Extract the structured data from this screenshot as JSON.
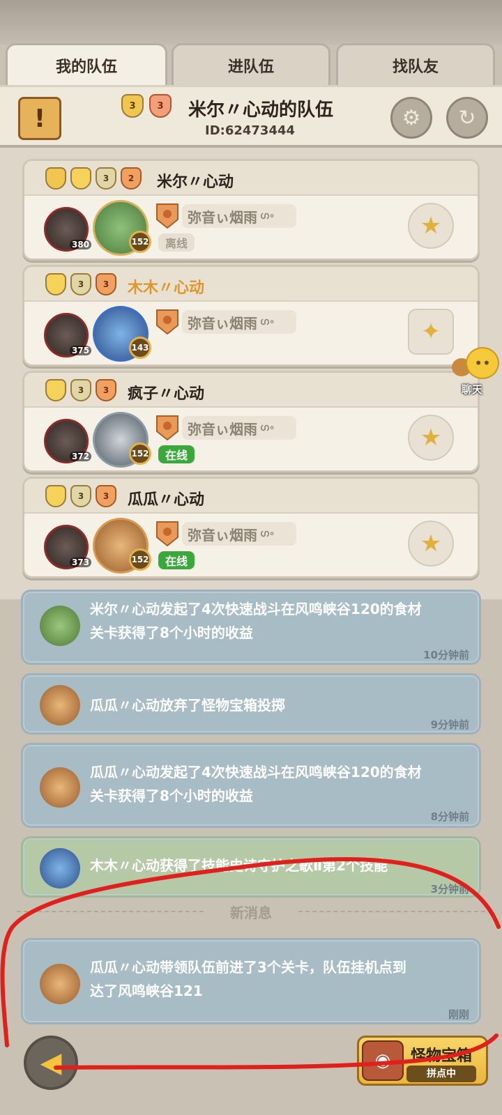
{
  "tabs": [
    {
      "label": "我的队伍",
      "active": true
    },
    {
      "label": "进队伍",
      "active": false
    },
    {
      "label": "找队友",
      "active": false
    }
  ],
  "header": {
    "title": "米尔〃心动的队伍",
    "team_id": "ID:62473444",
    "badges": [
      "3",
      "3"
    ]
  },
  "members": [
    {
      "name": "米尔〃心动",
      "main_level": "380",
      "pet_level": "152",
      "guild": "弥音ぃ烟雨",
      "status": "离线",
      "online": false,
      "is_self": false
    },
    {
      "name": "木木〃心动",
      "main_level": "375",
      "pet_level": "143",
      "guild": "弥音ぃ烟雨",
      "status": "",
      "online": null,
      "is_self": true
    },
    {
      "name": "疯子〃心动",
      "main_level": "372",
      "pet_level": "152",
      "guild": "弥音ぃ烟雨",
      "status": "在线",
      "online": true,
      "is_self": false
    },
    {
      "name": "瓜瓜〃心动",
      "main_level": "373",
      "pet_level": "152",
      "guild": "弥音ぃ烟雨",
      "status": "在线",
      "online": true,
      "is_self": false
    }
  ],
  "chat": {
    "label": "聊天"
  },
  "logs": [
    {
      "line1_name": "米尔〃心动",
      "line1_rest": "发起了4次快速战斗在风鸣峡谷120的食材",
      "line2": "关卡获得了8个小时的收益",
      "time": "10分钟前"
    },
    {
      "line1_name": "瓜瓜〃心动",
      "line1_rest": "放弃了怪物宝箱投掷",
      "line2": "",
      "time": "9分钟前"
    },
    {
      "line1_name": "瓜瓜〃心动",
      "line1_rest": "发起了4次快速战斗在风鸣峡谷120的食材",
      "line2": "关卡获得了8个小时的收益",
      "time": "8分钟前"
    },
    {
      "line1_name": "木木〃心动",
      "line1_rest": "获得了技能史诗守护之歌Ⅱ第2个技能",
      "line2": "",
      "time": "3分钟前"
    }
  ],
  "new_messages_label": "新消息",
  "latest_log": {
    "line1_name": "瓜瓜〃心动",
    "line1_rest": "带领队伍前进了3个关卡，队伍挂机点到",
    "line2": "达了风鸣峡谷121",
    "time": "刚刚"
  },
  "bottom": {
    "chest_label": "怪物宝箱",
    "chest_sub": "拼点中"
  },
  "colors": {
    "online": "#3aa83b",
    "self_name": "#e1962c",
    "log_bg": "#a8bcc6",
    "log_bg_skill": "#b6c9a7",
    "annotation": "#e0201c"
  }
}
